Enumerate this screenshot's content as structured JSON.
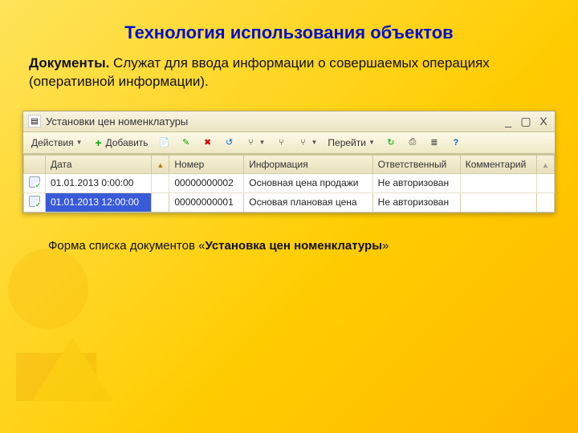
{
  "slide": {
    "title": "Технология использования объектов",
    "desc_bold": "Документы.",
    "desc_rest": " Служат для ввода информации о совершаемых операциях (оперативной информации).",
    "caption_lead": "Форма списка документов «",
    "caption_bold": "Установка цен номенклатуры",
    "caption_tail": "»"
  },
  "window": {
    "title": "Установки цен номенклатуры",
    "controls": {
      "min": "_",
      "restore": "▢",
      "close": "X"
    }
  },
  "toolbar": {
    "actions": "Действия",
    "add": "Добавить",
    "goto": "Перейти",
    "icons": {
      "copy": "📄",
      "edit": "✎",
      "delete": "✖",
      "refresh": "↺",
      "filter1": "⑂",
      "filter2": "⑂",
      "filter3": "⑂",
      "reload": "↻",
      "print": "⎙",
      "list": "≣",
      "help": "?"
    }
  },
  "table": {
    "headers": {
      "icon": "",
      "date": "Дата",
      "sort": "",
      "number": "Номер",
      "info": "Информация",
      "responsible": "Ответственный",
      "comment": "Комментарий",
      "scroll": ""
    },
    "rows": [
      {
        "date": "01.01.2013 0:00:00",
        "number": "00000000002",
        "info": "Основная цена продажи",
        "responsible": "Не авторизован",
        "comment": "",
        "selected": false
      },
      {
        "date": "01.01.2013 12:00:00",
        "number": "00000000001",
        "info": "Основая плановая цена",
        "responsible": "Не авторизован",
        "comment": "",
        "selected": true
      }
    ]
  }
}
